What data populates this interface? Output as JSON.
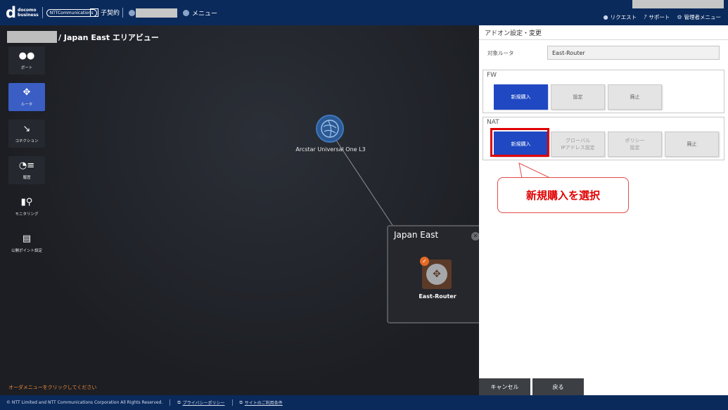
{
  "header": {
    "brand_mark": "d",
    "brand_text_1": "docomo",
    "brand_text_2": "business",
    "brand_ntt": "NTTCommunications",
    "contract_label": "子契約",
    "menu_label": "メニュー",
    "links": [
      "リクエスト",
      "サポート",
      "管理者メニュー"
    ]
  },
  "breadcrumb": "/ Japan East エリアビュー",
  "sidebar": {
    "items": [
      {
        "label": "ポート",
        "icon": "port-icon",
        "glyph": "●●"
      },
      {
        "label": "ルータ",
        "icon": "router-icon",
        "glyph": "✥"
      },
      {
        "label": "コネクション",
        "icon": "connection-icon",
        "glyph": "↘"
      },
      {
        "label": "履歴",
        "icon": "history-icon",
        "glyph": "◔≡"
      },
      {
        "label": "モニタリング",
        "icon": "monitoring-icon",
        "glyph": "▮⚲"
      },
      {
        "label": "公開ポイント設定",
        "icon": "public-point-icon",
        "glyph": "▤"
      }
    ]
  },
  "topology": {
    "cloud_label": "Arcstar Universal One L3",
    "region_title": "Japan East",
    "router_label": "East-Router"
  },
  "order_message": "オーダメニューをクリックしてください",
  "panel": {
    "title": "アドオン設定・変更",
    "target_label": "対象ルータ",
    "target_value": "East-Router",
    "fw": {
      "title": "FW",
      "buttons": [
        "新規購入",
        "設定",
        "廃止"
      ]
    },
    "nat": {
      "title": "NAT",
      "buttons": [
        "新規購入",
        "グローバル\nIPアドレス設定",
        "ポリシー\n設定",
        "廃止"
      ]
    },
    "cancel": "キャンセル",
    "back": "戻る"
  },
  "annotation": {
    "callout_text": "新規購入を選択"
  },
  "footer": {
    "copyright": "© NTT Limited and NTT Communications Corporation All Rights Reserved.",
    "privacy": "プライバシーポリシー",
    "terms": "サイトのご利用条件"
  },
  "colors": {
    "header_bg": "#0b2a5c",
    "primary_button": "#1f48c2",
    "active_nav": "#3a5ec4",
    "highlight": "#e00000",
    "router_badge": "#e76a25"
  }
}
